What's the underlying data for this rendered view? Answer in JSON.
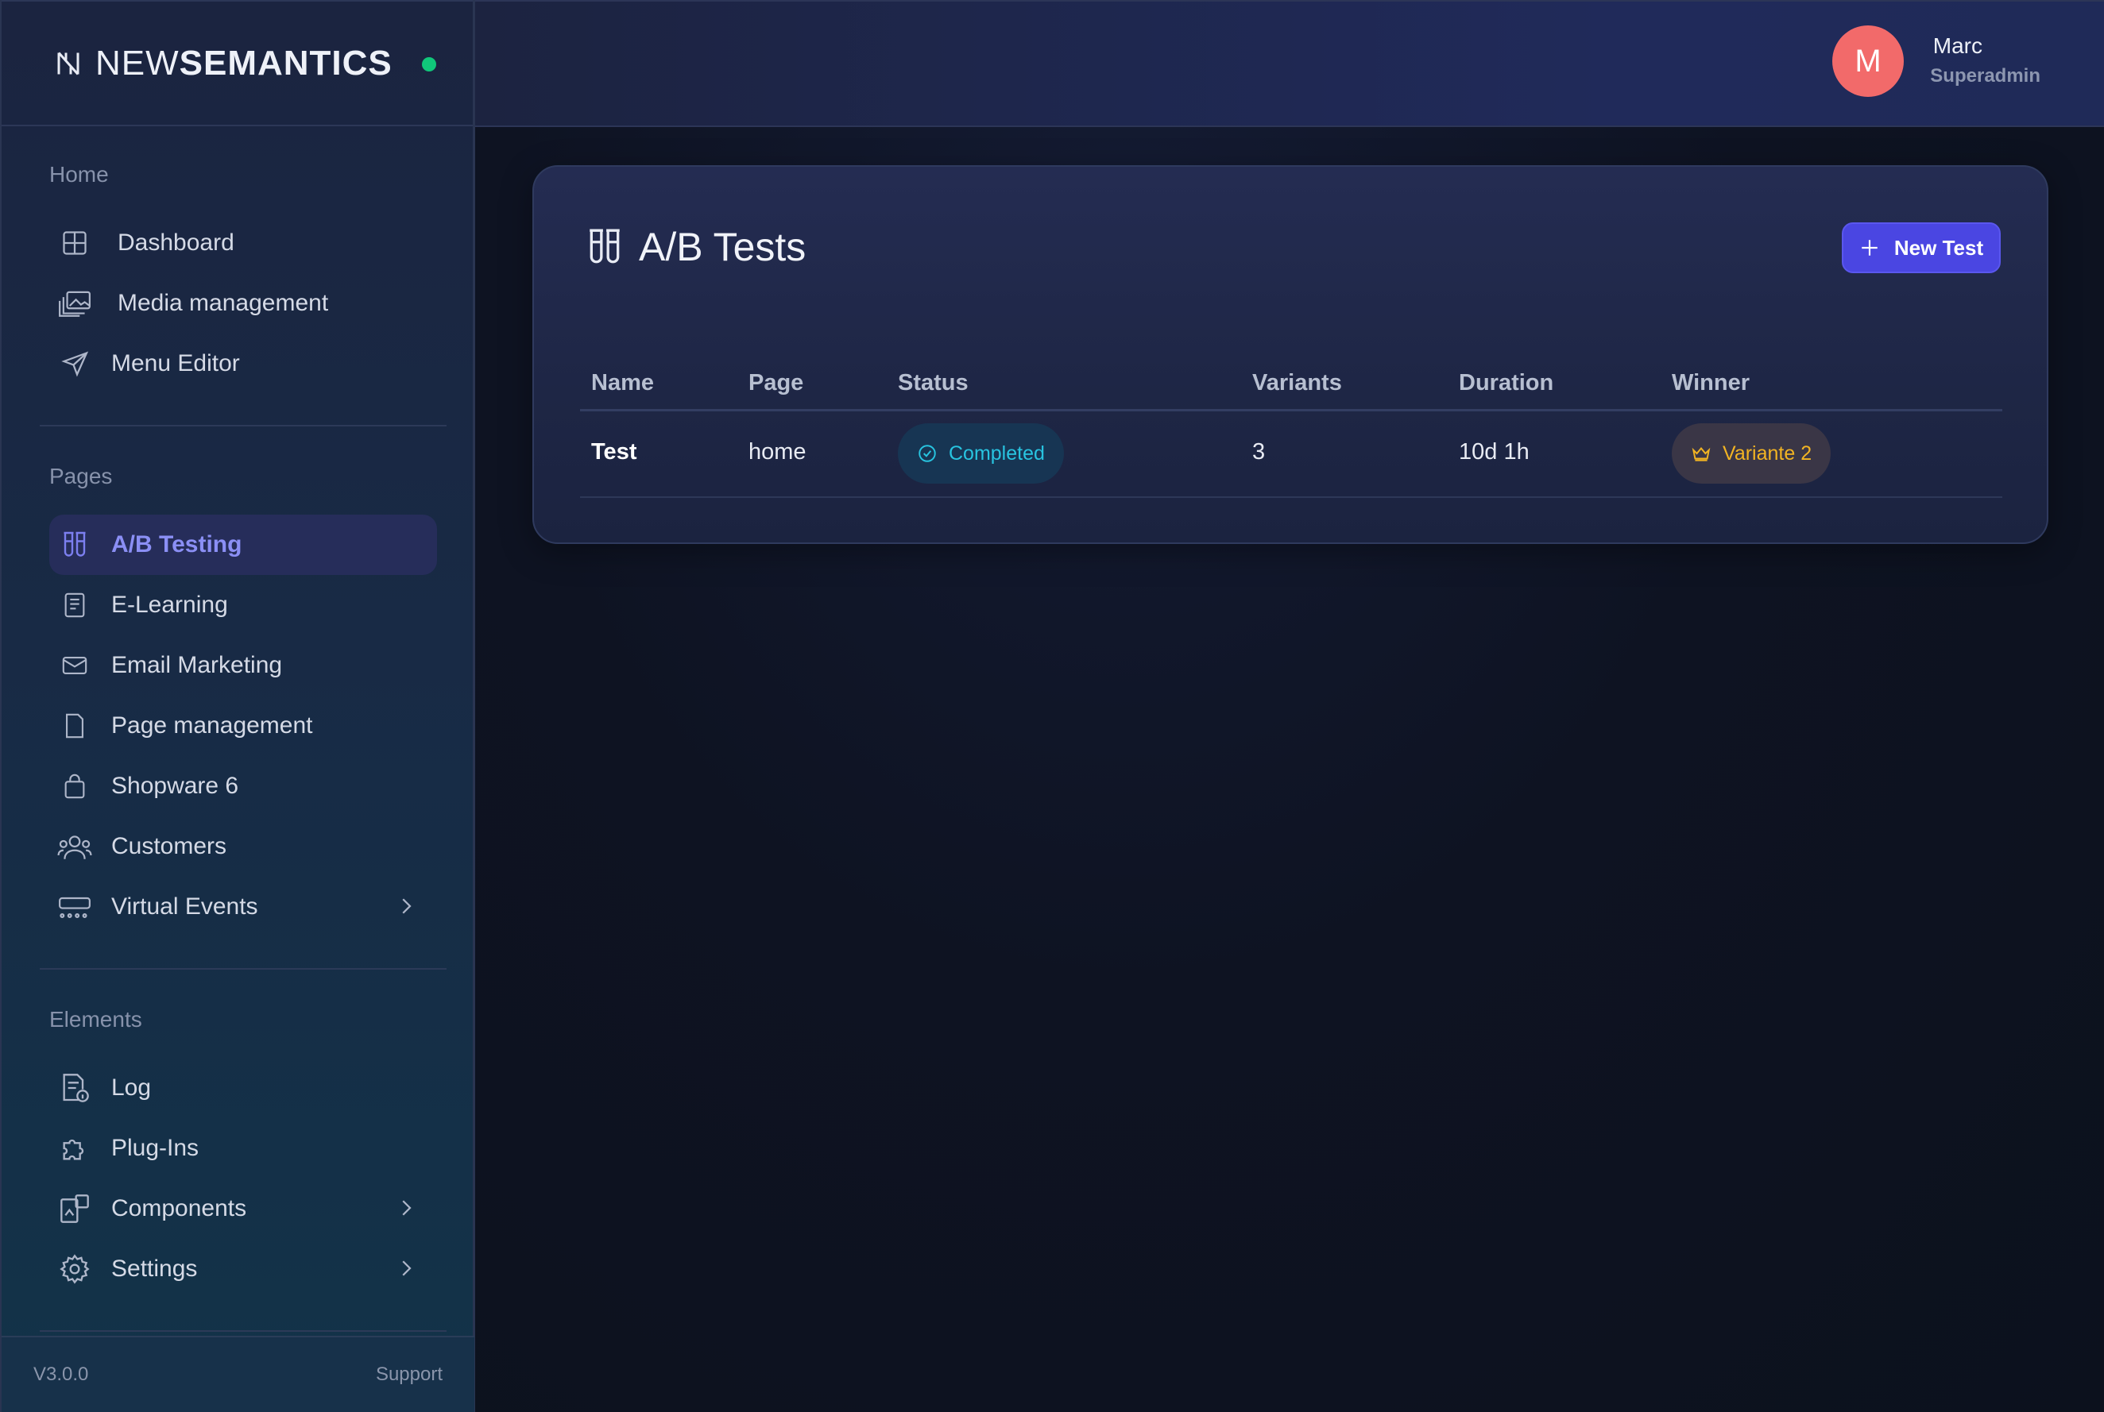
{
  "brand": {
    "light": "NEW",
    "bold": "SEMANTICS"
  },
  "user": {
    "initial": "M",
    "name": "Marc",
    "role": "Superadmin"
  },
  "sidebar": {
    "sections": [
      {
        "title": "Home",
        "items": [
          {
            "label": "Dashboard",
            "icon": "grid-icon"
          },
          {
            "label": "Media management",
            "icon": "images-icon"
          },
          {
            "label": "Menu Editor",
            "icon": "send-icon"
          }
        ]
      },
      {
        "title": "Pages",
        "items": [
          {
            "label": "A/B Testing",
            "icon": "test-tubes-icon",
            "active": true
          },
          {
            "label": "E-Learning",
            "icon": "book-icon"
          },
          {
            "label": "Email Marketing",
            "icon": "mail-icon"
          },
          {
            "label": "Page management",
            "icon": "file-icon"
          },
          {
            "label": "Shopware 6",
            "icon": "shopping-bag-icon"
          },
          {
            "label": "Customers",
            "icon": "users-icon"
          },
          {
            "label": "Virtual Events",
            "icon": "projector-icon",
            "chevron": true
          }
        ]
      },
      {
        "title": "Elements",
        "items": [
          {
            "label": "Log",
            "icon": "log-file-icon"
          },
          {
            "label": "Plug-Ins",
            "icon": "puzzle-icon"
          },
          {
            "label": "Components",
            "icon": "components-icon",
            "chevron": true
          },
          {
            "label": "Settings",
            "icon": "gear-icon",
            "chevron": true
          }
        ]
      }
    ],
    "footer": {
      "version": "V3.0.0",
      "support": "Support"
    }
  },
  "page": {
    "title": "A/B Tests",
    "new_button": "New Test",
    "table": {
      "headers": [
        "Name",
        "Page",
        "Status",
        "Variants",
        "Duration",
        "Winner"
      ],
      "rows": [
        {
          "name": "Test",
          "page": "home",
          "status": "Completed",
          "variants": "3",
          "duration": "10d 1h",
          "winner": "Variante 2"
        }
      ]
    }
  },
  "colors": {
    "accent": "#4a46e2",
    "status_online": "#10c77a",
    "completed": "#28c4e0",
    "winner": "#f2b423",
    "avatar": "#f26a6a"
  }
}
